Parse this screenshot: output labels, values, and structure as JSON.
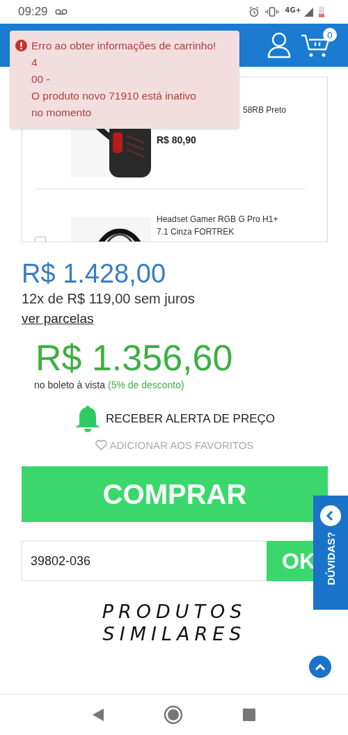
{
  "status_bar": {
    "time": "09:29",
    "network": "4G+"
  },
  "header": {
    "cart_count": "0"
  },
  "error_toast": {
    "lines": [
      "Erro ao obter informações de carrinho!",
      "4",
      "00 -",
      "O produto novo 71910 está inativo",
      "no momento"
    ]
  },
  "product_list": {
    "items": [
      {
        "title": "58RB Preto",
        "price": "R$ 80,90",
        "covered": true
      },
      {
        "title": "Headset Gamer RGB G Pro H1+ 7.1 Cinza FORTREK",
        "covered": false,
        "checked": false
      }
    ]
  },
  "price": {
    "list_price": "R$ 1.428,00",
    "installments": "12x de R$ 119,00 sem juros",
    "installments_link": "ver parcelas",
    "cash_price": "R$ 1.356,60",
    "cash_note": "no boleto à vista",
    "discount": "(5% de desconto)"
  },
  "price_alert": "RECEBER ALERTA DE PREÇO",
  "favorites": "ADICIONAR AOS FAVORITOS",
  "buy_button": "COMPRAR",
  "shipping": {
    "zip_value": "39802-036",
    "button": "OK"
  },
  "help_tab": "DÚVIDAS?",
  "similar_heading": "PRODUTOS SIMILARES"
}
